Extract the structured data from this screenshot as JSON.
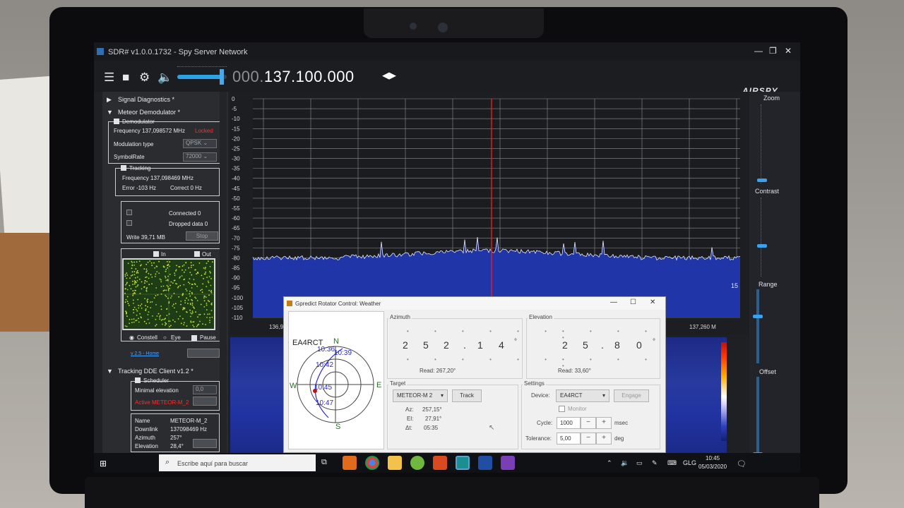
{
  "window": {
    "title": "SDR# v1.0.0.1732 - Spy Server Network",
    "minimize": "—",
    "maximize": "❐",
    "close": "✕"
  },
  "toolbar": {
    "menu_icon": "hamburger-icon",
    "stop_icon": "stop-icon",
    "settings_icon": "gear-icon",
    "audio_icon": "speaker-icon",
    "volume_level": 0.9,
    "frequency_prefix": "000.",
    "frequency_main": "137.100.000",
    "brand": "AIRSPY"
  },
  "left_panel": {
    "signal_diagnostics": "Signal Diagnostics *",
    "meteor_demodulator": "Meteor Demodulator *",
    "demodulator": {
      "label": "Demodulator",
      "frequency_label": "Frequency 137,098572 MHz",
      "status": "Locked",
      "modulation_type_label": "Modulation type",
      "modulation_type_value": "QPSK",
      "symbolrate_label": "SymbolRate",
      "symbolrate_value": "72000"
    },
    "tracking": {
      "label": "Tracking",
      "frequency": "Frequency 137,098469 MHz",
      "error": "Error -103 Hz",
      "correct": "Correct 0 Hz"
    },
    "connection": {
      "connected": "Connected 0",
      "dropped": "Dropped data 0",
      "write": "Write 39,71 MB",
      "stop_button": "Stop"
    },
    "constellation": {
      "in_label": "In",
      "out_label": "Out",
      "constell_label": "Constell",
      "eye_label": "Eye",
      "pause_label": "Pause"
    },
    "version_link": "v 2.5 - Home",
    "tracking_dde": "Tracking DDE Client v1.2 *",
    "scheduler": {
      "label": "Scheduler",
      "min_elevation_label": "Minimal elevation",
      "min_elevation_value": "0,0",
      "active": "Active METEOR-M_2"
    },
    "satellite_info": {
      "rows": [
        {
          "key": "Name",
          "value": "METEOR-M_2"
        },
        {
          "key": "Downlink",
          "value": "137098469 Hz"
        },
        {
          "key": "Azimuth",
          "value": "257°"
        },
        {
          "key": "Elevation",
          "value": "28,4°"
        }
      ]
    }
  },
  "spectrum": {
    "y_ticks": [
      "0",
      "-5",
      "-10",
      "-15",
      "-20",
      "-25",
      "-30",
      "-35",
      "-40",
      "-45",
      "-50",
      "-55",
      "-60",
      "-65",
      "-70",
      "-75",
      "-80",
      "-85",
      "-90",
      "-95",
      "-100",
      "-105",
      "-110"
    ],
    "x_left": "136,95",
    "x_right": "137,260 M",
    "side_value": "15"
  },
  "right_controls": {
    "zoom": "Zoom",
    "contrast": "Contrast",
    "range": "Range",
    "offset": "Offset"
  },
  "gpredict": {
    "title": "Gpredict Rotator Control: Weather",
    "polar": {
      "station": "EA4RCT",
      "north": "N",
      "south": "S",
      "east": "E",
      "west": "W",
      "times": [
        "10:36",
        "10:39",
        "10:42",
        "10:45",
        "10:47"
      ]
    },
    "azimuth": {
      "label": "Azimuth",
      "digits": [
        "2",
        "5",
        "2",
        ".",
        "1",
        "4"
      ],
      "unit": "°",
      "read": "Read:  267,20°"
    },
    "elevation": {
      "label": "Elevation",
      "digits": [
        "2",
        "5",
        ".",
        "8",
        "0"
      ],
      "unit": "°",
      "read": "Read:  33,60°"
    },
    "target": {
      "label": "Target",
      "satellite": "METEOR-M 2",
      "track_button": "Track",
      "az": "Az:",
      "az_value": "257,15°",
      "el": "El:",
      "el_value": "27,91°",
      "dt": "Δt:",
      "dt_value": "05:35"
    },
    "settings": {
      "label": "Settings",
      "device_label": "Device:",
      "device_value": "EA4RCT",
      "engage_button": "Engage",
      "monitor_label": "Monitor",
      "cycle_label": "Cycle:",
      "cycle_value": "1000",
      "cycle_unit": "msec",
      "tolerance_label": "Tolerance:",
      "tolerance_value": "5,00",
      "tolerance_unit": "deg",
      "minus": "−",
      "plus": "+"
    }
  },
  "taskbar": {
    "search_placeholder": "Escribe aquí para buscar",
    "language": "GLG",
    "time": "10:45",
    "date": "05/03/2020"
  }
}
